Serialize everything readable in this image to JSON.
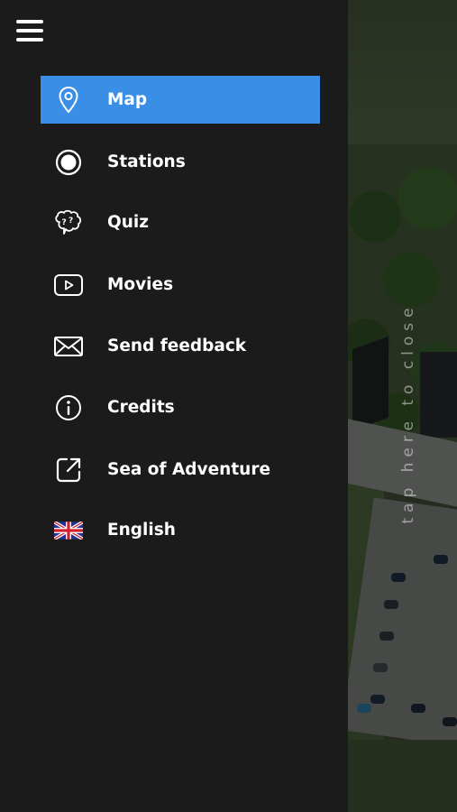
{
  "menu": {
    "items": [
      {
        "label": "Map",
        "icon": "map-pin-icon",
        "active": true
      },
      {
        "label": "Stations",
        "icon": "station-dot-icon",
        "active": false
      },
      {
        "label": "Quiz",
        "icon": "brain-question-icon",
        "active": false
      },
      {
        "label": "Movies",
        "icon": "play-video-icon",
        "active": false
      },
      {
        "label": "Send feedback",
        "icon": "envelope-icon",
        "active": false
      },
      {
        "label": "Credits",
        "icon": "info-icon",
        "active": false
      },
      {
        "label": "Sea of Adventure",
        "icon": "external-link-icon",
        "active": false
      },
      {
        "label": "English",
        "icon": "uk-flag-icon",
        "active": false
      }
    ]
  },
  "overlay": {
    "close_hint": "tap here to close"
  },
  "colors": {
    "drawer_bg": "#1b1b1b",
    "active_item": "#3a8ee6",
    "text": "#ffffff"
  }
}
